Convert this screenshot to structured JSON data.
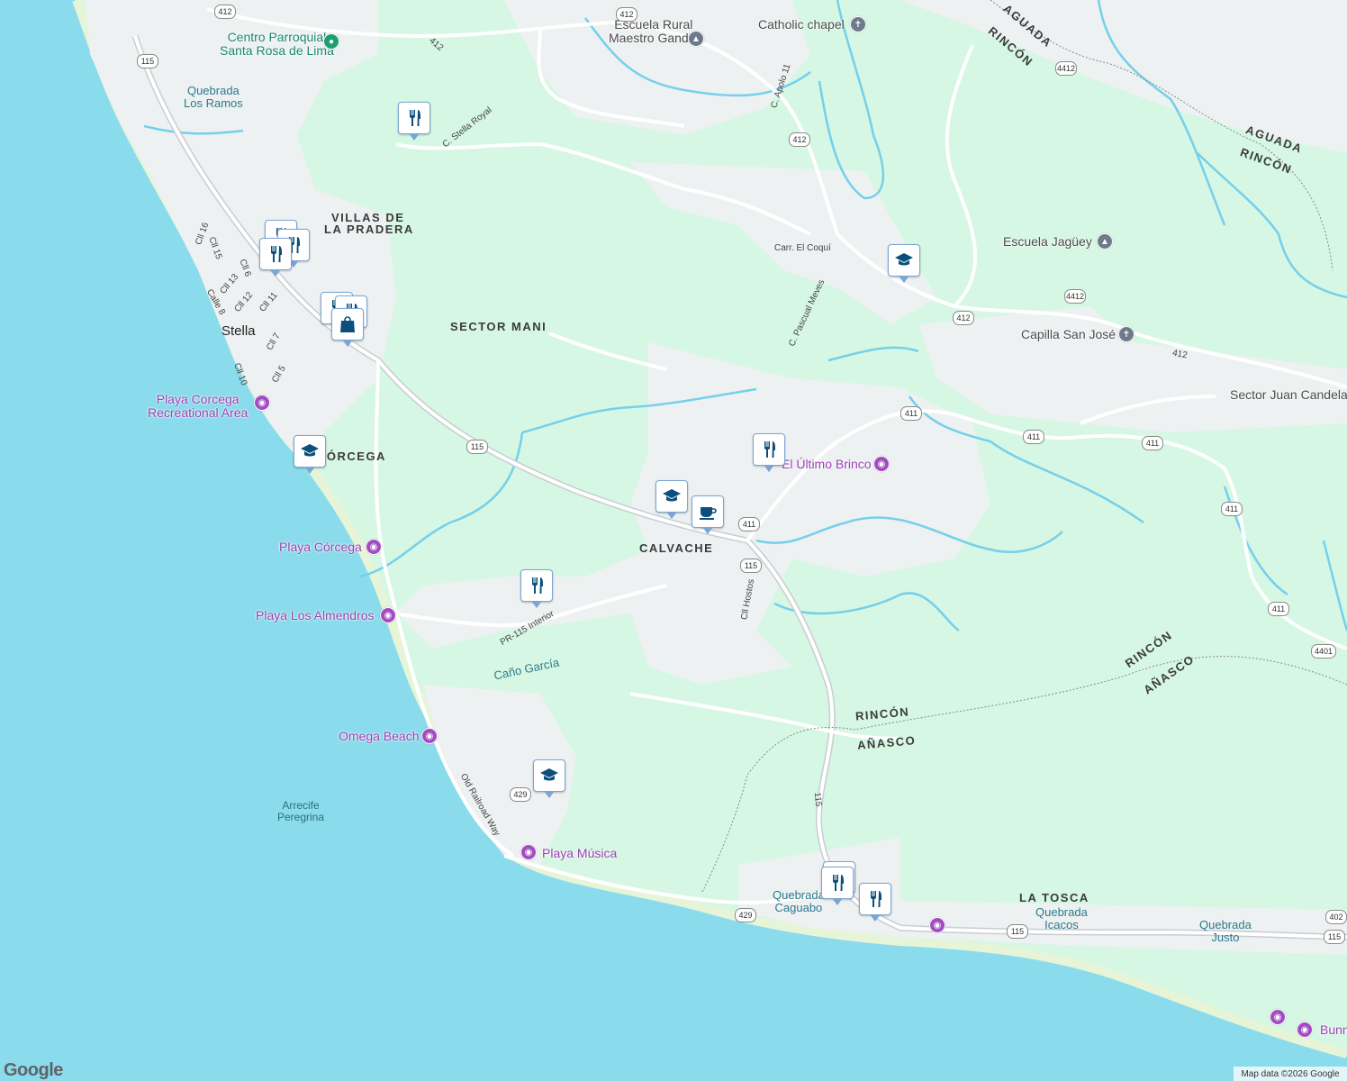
{
  "map": {
    "colors": {
      "land": "#d6f7e3",
      "ocean": "#8adcec",
      "urban": "#eef1f2",
      "road": "#ffffff",
      "river": "#74d0ec",
      "pin_icon": "#0b4f7c"
    },
    "areas": [
      "VILLAS DE",
      "LA PRADERA",
      "SECTOR MANI",
      "CÓRCEGA",
      "CALVACHE",
      "LA TOSCA",
      "AGUADA",
      "RINCÓN",
      "AGUADA",
      "RINCÓN",
      "RINCÓN",
      "AÑASCO",
      "RINCÓN",
      "AÑASCO"
    ],
    "pois": {
      "centro": [
        "Centro Parroquial",
        "Santa Rosa de Lima"
      ],
      "escuela_rural": [
        "Escuela Rural",
        "Maestro Gandia"
      ],
      "catholic_chapel": "Catholic chapel",
      "escuela_jaguey": "Escuela Jagüey",
      "capilla": "Capilla San José",
      "sector_juan": "Sector Juan Candelaria",
      "el_ultimo": "El Último Brinco",
      "playa_corcega_rec": [
        "Playa Corcega",
        "Recreational Area"
      ],
      "playa_corcega": "Playa Córcega",
      "playa_almendros": "Playa Los Almendros",
      "omega": "Omega Beach",
      "playa_musica": "Playa Música",
      "bunny": "Bunny"
    },
    "water": {
      "quebrada_ramos": [
        "Quebrada",
        "Los Ramos"
      ],
      "cano_garcia": "Caño García",
      "arrecife": [
        "Arrecife",
        "Peregrina"
      ],
      "quebrada_caguabo": [
        "Quebrada",
        "Caguabo"
      ],
      "quebrada_icacos": [
        "Quebrada",
        "Icacos"
      ],
      "quebrada_justo": [
        "Quebrada",
        "Justo"
      ]
    },
    "town": "Stella",
    "streets": [
      "C. Stella Royal",
      "C. Apolo 11",
      "Carr. El Coquí",
      "C. Pascual Meves",
      "Cll 16",
      "Cll 15",
      "Cll 6",
      "Cll 13",
      "Cll 12",
      "Calle 8",
      "Cll 11",
      "Cll 7",
      "Cll 10",
      "Cll 5",
      "PR-115 Interior",
      "Cll Hostos",
      "Old Railroad Way",
      "115",
      "412"
    ],
    "shields": [
      "412",
      "412",
      "115",
      "412",
      "4412",
      "4412",
      "412",
      "411",
      "411",
      "411",
      "411",
      "411",
      "115",
      "411",
      "115",
      "4401",
      "429",
      "429",
      "115",
      "402",
      "115"
    ],
    "pin_icons": [
      "restaurant-icon",
      "school-icon",
      "shopping-bag-icon",
      "cafe-icon"
    ],
    "attribution": "Map data ©2026 Google",
    "logo": "Google"
  }
}
